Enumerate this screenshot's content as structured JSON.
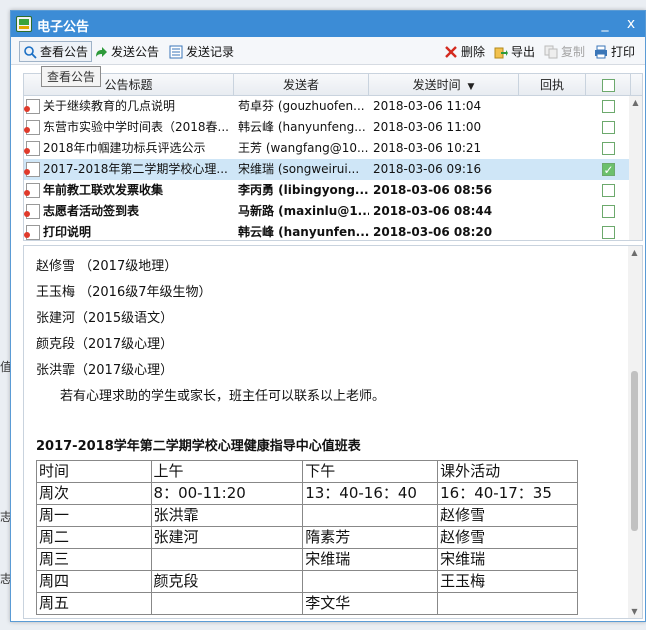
{
  "window": {
    "title": "电子公告",
    "minimize": "_",
    "close": "x"
  },
  "toolbar": {
    "view": "查看公告",
    "send": "发送公告",
    "records": "发送记录",
    "delete": "删除",
    "export": "导出",
    "copy": "复制",
    "print": "打印",
    "tooltip": "查看公告"
  },
  "grid": {
    "columns": [
      "公告标题",
      "发送者",
      "发送时间",
      "回执",
      ""
    ],
    "rows": [
      {
        "title": "关于继续教育的几点说明",
        "sender": "苟卓芬 (gouzhuofen...",
        "time": "2018-03-06 11:04",
        "checked": false,
        "bold": false,
        "selected": false
      },
      {
        "title": "东营市实验中学时间表（2018春...",
        "sender": "韩云峰 (hanyunfeng...",
        "time": "2018-03-06 11:00",
        "checked": false,
        "bold": false,
        "selected": false
      },
      {
        "title": "2018年巾帼建功标兵评选公示",
        "sender": "王芳 (wangfang@10...",
        "time": "2018-03-06 10:21",
        "checked": false,
        "bold": false,
        "selected": false
      },
      {
        "title": "2017-2018年第二学期学校心理...",
        "sender": "宋维瑞 (songweirui...",
        "time": "2018-03-06 09:16",
        "checked": true,
        "bold": false,
        "selected": true
      },
      {
        "title": "年前教工联欢发票收集",
        "sender": "李丙勇 (libingyong...",
        "time": "2018-03-06 08:56",
        "checked": false,
        "bold": true,
        "selected": false
      },
      {
        "title": "志愿者活动签到表",
        "sender": "马新路 (maxinlu@1...",
        "time": "2018-03-06 08:44",
        "checked": false,
        "bold": true,
        "selected": false
      },
      {
        "title": "打印说明",
        "sender": "韩云峰 (hanyunfen...",
        "time": "2018-03-06 08:20",
        "checked": false,
        "bold": true,
        "selected": false
      }
    ]
  },
  "detail": {
    "names": [
      "赵修雪 （2017级地理）",
      "王玉梅 （2016级7年级生物）",
      "张建河（2015级语文）",
      "颜克段（2017级心理）",
      "张洪霏（2017级心理）"
    ],
    "note": "若有心理求助的学生或家长，班主任可以联系以上老师。",
    "table_title": "2017-2018学年第二学期学校心理健康指导中心值班表",
    "table": {
      "header1": [
        "时间",
        "上午",
        "下午",
        "课外活动"
      ],
      "header2": [
        "周次",
        "8：00-11:20",
        "13：40-16：40",
        "16：40-17：35"
      ],
      "rows": [
        [
          "周一",
          "张洪霏",
          "",
          "赵修雪"
        ],
        [
          "周二",
          "张建河",
          "隋素芳",
          "赵修雪"
        ],
        [
          "周三",
          "",
          "宋维瑞",
          "宋维瑞"
        ],
        [
          "周四",
          "颜克段",
          "",
          "王玉梅"
        ],
        [
          "周五",
          "",
          "李文华",
          ""
        ]
      ]
    }
  },
  "colors": {
    "titlebar": "#3c8cd6",
    "selected_row": "#cfe6f7",
    "checkbox": "#6cc06c"
  }
}
